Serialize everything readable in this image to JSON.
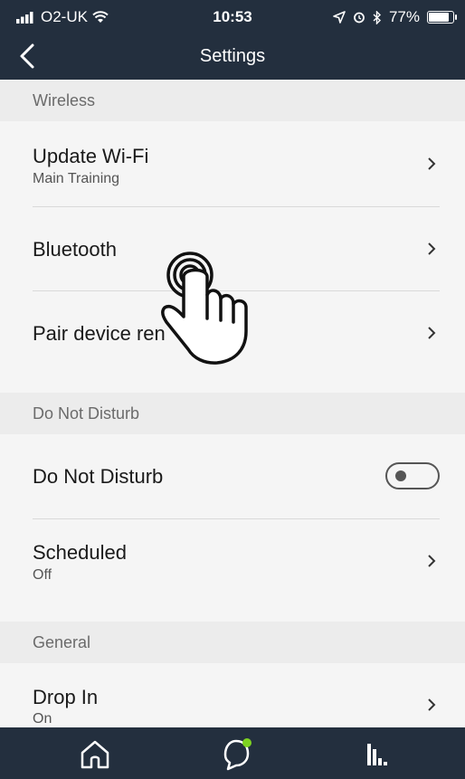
{
  "status_bar": {
    "carrier": "O2-UK",
    "time": "10:53",
    "battery": "77%",
    "icons": [
      "signal-icon",
      "wifi-icon",
      "location-icon",
      "alarm-icon",
      "bluetooth-icon",
      "battery-icon"
    ]
  },
  "header": {
    "title": "Settings",
    "back_icon": "chevron-left-icon"
  },
  "sections": {
    "wireless": {
      "title": "Wireless",
      "update_wifi": {
        "label": "Update Wi-Fi",
        "value": "Main Training"
      },
      "bluetooth": {
        "label": "Bluetooth"
      },
      "pair_remote": {
        "label": "Pair device ren"
      }
    },
    "do_not_disturb": {
      "title": "Do Not Disturb",
      "toggle": {
        "label": "Do Not Disturb",
        "state": "off"
      },
      "scheduled": {
        "label": "Scheduled",
        "value": "Off"
      }
    },
    "general": {
      "title": "General",
      "drop_in": {
        "label": "Drop In",
        "value": "On"
      }
    }
  },
  "tab_bar": {
    "tabs": [
      "home-icon",
      "chat-icon",
      "equalizer-icon"
    ],
    "chat_badge_color": "#7ed321"
  },
  "colors": {
    "bar_background": "#232f3e",
    "section_background": "#ececec",
    "row_background": "#f5f5f5"
  }
}
